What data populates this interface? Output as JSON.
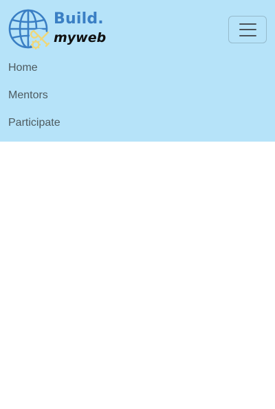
{
  "brand": {
    "word1": "Build.",
    "word2": "myweb",
    "logo_icon": "globe-with-tools-icon",
    "colors": {
      "primary_blue": "#3a7fc4",
      "tool_yellow": "#f0d777",
      "dark_text": "#111111"
    }
  },
  "navbar": {
    "background": "#b6e3f9",
    "toggler_icon": "hamburger-icon",
    "items": [
      {
        "label": "Home"
      },
      {
        "label": "Mentors"
      },
      {
        "label": "Participate"
      }
    ]
  }
}
